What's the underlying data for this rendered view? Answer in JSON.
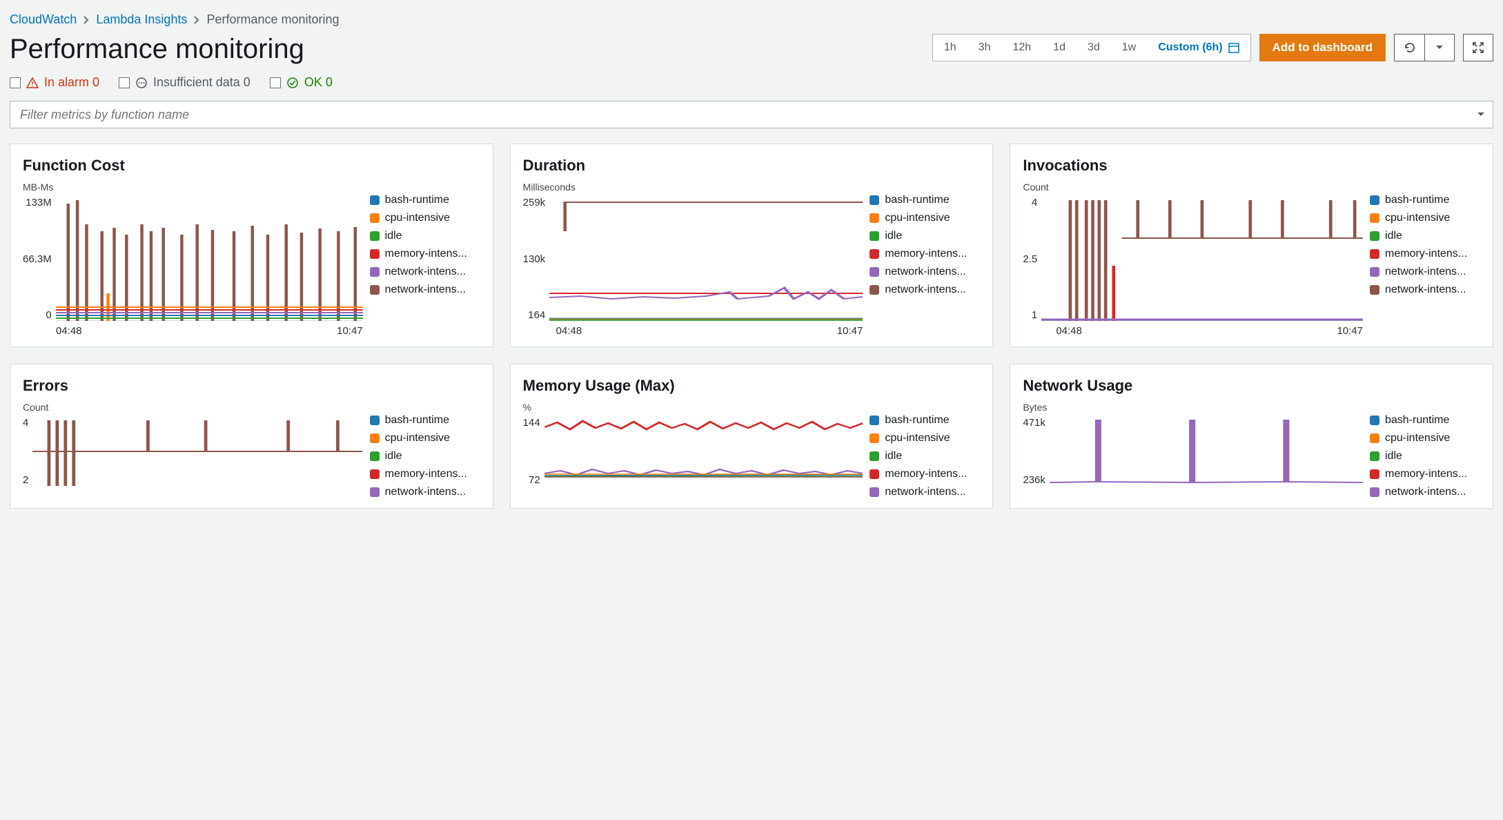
{
  "breadcrumb": {
    "items": [
      {
        "label": "CloudWatch",
        "link": true
      },
      {
        "label": "Lambda Insights",
        "link": true
      },
      {
        "label": "Performance monitoring",
        "link": false
      }
    ]
  },
  "header": {
    "title": "Performance monitoring",
    "time_ranges": [
      "1h",
      "3h",
      "12h",
      "1d",
      "3d",
      "1w"
    ],
    "custom_label": "Custom (6h)",
    "add_button": "Add to dashboard"
  },
  "alarm_filters": {
    "in_alarm": {
      "label": "In alarm 0"
    },
    "insufficient": {
      "label": "Insufficient data 0"
    },
    "ok": {
      "label": "OK 0"
    }
  },
  "filter": {
    "placeholder": "Filter metrics by function name"
  },
  "legend_series": [
    {
      "name": "bash-runtime",
      "color": "#1f77b4"
    },
    {
      "name": "cpu-intensive",
      "color": "#ff7f0e"
    },
    {
      "name": "idle",
      "color": "#2ca02c"
    },
    {
      "name": "memory-intens...",
      "color": "#d62728"
    },
    {
      "name": "network-intens...",
      "color": "#9467bd"
    },
    {
      "name": "network-intens...",
      "color": "#8c564b"
    }
  ],
  "legend_series_5": [
    {
      "name": "bash-runtime",
      "color": "#1f77b4"
    },
    {
      "name": "cpu-intensive",
      "color": "#ff7f0e"
    },
    {
      "name": "idle",
      "color": "#2ca02c"
    },
    {
      "name": "memory-intens...",
      "color": "#d62728"
    },
    {
      "name": "network-intens...",
      "color": "#9467bd"
    }
  ],
  "charts": {
    "function_cost": {
      "title": "Function Cost",
      "unit": "MB-Ms",
      "y_ticks": [
        "133M",
        "66.3M",
        "0"
      ],
      "x_ticks": [
        "04:48",
        "10:47"
      ]
    },
    "duration": {
      "title": "Duration",
      "unit": "Milliseconds",
      "y_ticks": [
        "259k",
        "130k",
        "164"
      ],
      "x_ticks": [
        "04:48",
        "10:47"
      ]
    },
    "invocations": {
      "title": "Invocations",
      "unit": "Count",
      "y_ticks": [
        "4",
        "2.5",
        "1"
      ],
      "x_ticks": [
        "04:48",
        "10:47"
      ]
    },
    "errors": {
      "title": "Errors",
      "unit": "Count",
      "y_ticks": [
        "4",
        "2"
      ],
      "x_ticks": []
    },
    "memory_usage": {
      "title": "Memory Usage (Max)",
      "unit": "%",
      "y_ticks": [
        "144",
        "72"
      ],
      "x_ticks": []
    },
    "network_usage": {
      "title": "Network Usage",
      "unit": "Bytes",
      "y_ticks": [
        "471k",
        "236k"
      ],
      "x_ticks": []
    }
  },
  "chart_data": [
    {
      "type": "line",
      "title": "Function Cost",
      "xlabel": "",
      "ylabel": "MB-Ms",
      "x_range": [
        "04:48",
        "10:47"
      ],
      "ylim": [
        0,
        133000000
      ],
      "series": [
        {
          "name": "bash-runtime",
          "approx_range": [
            5000000,
            10000000
          ]
        },
        {
          "name": "cpu-intensive",
          "approx_range": [
            5000000,
            20000000
          ]
        },
        {
          "name": "idle",
          "approx_range": [
            3000000,
            8000000
          ]
        },
        {
          "name": "memory-intensive",
          "approx_range": [
            5000000,
            15000000
          ]
        },
        {
          "name": "network-intensive-a",
          "approx_range": [
            10000000,
            15000000
          ]
        },
        {
          "name": "network-intensive-b",
          "approx_range": [
            5000000,
            133000000
          ],
          "pattern": "spiky"
        }
      ]
    },
    {
      "type": "line",
      "title": "Duration",
      "xlabel": "",
      "ylabel": "Milliseconds",
      "x_range": [
        "04:48",
        "10:47"
      ],
      "ylim": [
        164,
        259000
      ],
      "series": [
        {
          "name": "bash-runtime",
          "approx_value": 2000
        },
        {
          "name": "cpu-intensive",
          "approx_value": 2000
        },
        {
          "name": "idle",
          "approx_value": 164
        },
        {
          "name": "memory-intensive",
          "approx_value": 60000
        },
        {
          "name": "network-intensive-a",
          "approx_value": 55000,
          "pattern": "noisy"
        },
        {
          "name": "network-intensive-b",
          "approx_value": 259000,
          "pattern": "step-at-start"
        }
      ]
    },
    {
      "type": "line",
      "title": "Invocations",
      "xlabel": "",
      "ylabel": "Count",
      "x_range": [
        "04:48",
        "10:47"
      ],
      "ylim": [
        1,
        4
      ],
      "series": [
        {
          "name": "bash-runtime",
          "approx_value": 1
        },
        {
          "name": "cpu-intensive",
          "approx_value": 1
        },
        {
          "name": "idle",
          "approx_value": 1
        },
        {
          "name": "memory-intensive",
          "approx_value": 1
        },
        {
          "name": "network-intensive-a",
          "approx_value": 1
        },
        {
          "name": "network-intensive-b",
          "approx_range": [
            1,
            4
          ],
          "pattern": "spiky-step-2"
        }
      ]
    },
    {
      "type": "line",
      "title": "Errors",
      "xlabel": "",
      "ylabel": "Count",
      "x_range": [
        "04:48",
        "10:47"
      ],
      "ylim": [
        0,
        4
      ],
      "series": [
        {
          "name": "bash-runtime",
          "approx_value": 0
        },
        {
          "name": "cpu-intensive",
          "approx_value": 0
        },
        {
          "name": "idle",
          "approx_value": 0
        },
        {
          "name": "memory-intensive",
          "approx_value": 0
        },
        {
          "name": "network-intensive-a",
          "approx_value": 0
        },
        {
          "name": "network-intensive-b",
          "approx_range": [
            0,
            4
          ],
          "pattern": "spiky"
        }
      ]
    },
    {
      "type": "line",
      "title": "Memory Usage (Max)",
      "xlabel": "",
      "ylabel": "%",
      "x_range": [
        "04:48",
        "10:47"
      ],
      "ylim": [
        0,
        144
      ],
      "series": [
        {
          "name": "bash-runtime",
          "approx_value": 70
        },
        {
          "name": "cpu-intensive",
          "approx_value": 70
        },
        {
          "name": "idle",
          "approx_value": 68
        },
        {
          "name": "memory-intensive",
          "approx_value": 140,
          "pattern": "noisy"
        },
        {
          "name": "network-intensive-a",
          "approx_value": 72
        },
        {
          "name": "network-intensive-b",
          "approx_value": 72
        }
      ]
    },
    {
      "type": "line",
      "title": "Network Usage",
      "xlabel": "",
      "ylabel": "Bytes",
      "x_range": [
        "04:48",
        "10:47"
      ],
      "ylim": [
        0,
        471000
      ],
      "series": [
        {
          "name": "bash-runtime",
          "approx_value": 215000
        },
        {
          "name": "cpu-intensive",
          "approx_value": 215000
        },
        {
          "name": "idle",
          "approx_value": 215000
        },
        {
          "name": "memory-intensive",
          "approx_value": 215000
        },
        {
          "name": "network-intensive-a",
          "approx_range": [
            215000,
            471000
          ],
          "pattern": "spikes-3"
        },
        {
          "name": "network-intensive-b",
          "approx_value": 215000
        }
      ]
    }
  ]
}
